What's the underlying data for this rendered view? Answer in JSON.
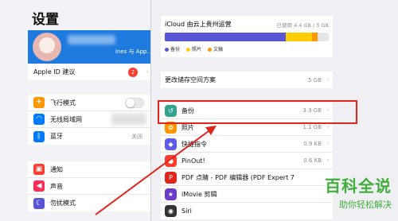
{
  "left": {
    "title": "设置",
    "profile_sub": "ines 与 App...",
    "apple_id_suggest": {
      "label": "Apple ID 建议",
      "badge": "2"
    },
    "connectivity": [
      {
        "label": "飞行模式",
        "icon": "airplane-icon",
        "color": "#ff9500",
        "glyph": "✈"
      },
      {
        "label": "无线局域网",
        "icon": "wifi-icon",
        "color": "#007aff",
        "glyph": "◠"
      },
      {
        "label": "蓝牙",
        "icon": "bluetooth-icon",
        "color": "#007aff",
        "glyph": "ᛒ",
        "value": "关闭"
      }
    ],
    "notify": [
      {
        "label": "通知",
        "icon": "notification-icon",
        "color": "#ff3b30",
        "glyph": "▣"
      },
      {
        "label": "声音",
        "icon": "sound-icon",
        "color": "#ff2d55",
        "glyph": "◀"
      },
      {
        "label": "勿扰模式",
        "icon": "moon-icon",
        "color": "#5856d6",
        "glyph": "☾"
      }
    ]
  },
  "right": {
    "storage": {
      "title": "iCloud 由云上贵州运营",
      "used": "已使用 4.4 GB / 5 GB",
      "segments": [
        {
          "name": "备份",
          "fraction": 0.74,
          "color": "#5856d6"
        },
        {
          "name": "照片",
          "fraction": 0.16,
          "color": "#ffcc00"
        },
        {
          "name": "文稿",
          "fraction": 0.03,
          "color": "#ff9500"
        }
      ]
    },
    "plan": {
      "label": "更改储存空间方案",
      "value": "5 GB"
    },
    "apps": [
      {
        "label": "备份",
        "value": "3.3 GB",
        "icon": "backup-icon",
        "color": "#34a38d",
        "glyph": "↺"
      },
      {
        "label": "照片",
        "value": "1.1 GB",
        "icon": "photos-icon",
        "color": "#ff9500",
        "glyph": "✿"
      },
      {
        "label": "快捷指令",
        "value": "0.9 KB",
        "icon": "shortcuts-icon",
        "color": "#5e5ce6",
        "glyph": "◆"
      },
      {
        "label": "PinOut!",
        "value": "0.6 KB",
        "icon": "pinout-icon",
        "color": "#ff3b30",
        "glyph": "●"
      },
      {
        "label": "PDF 点睛 - PDF 编辑器 (PDF Expert 7",
        "value": "",
        "icon": "pdf-icon",
        "color": "#e0261b",
        "glyph": "P"
      },
      {
        "label": "iMovie 剪辑",
        "value": "",
        "icon": "imovie-icon",
        "color": "#6a3cc9",
        "glyph": "★"
      },
      {
        "label": "Siri",
        "value": "",
        "icon": "siri-icon",
        "color": "#333333",
        "glyph": "◉"
      }
    ]
  },
  "watermark": {
    "main": "百科全说",
    "sub": "助你轻松解决"
  }
}
